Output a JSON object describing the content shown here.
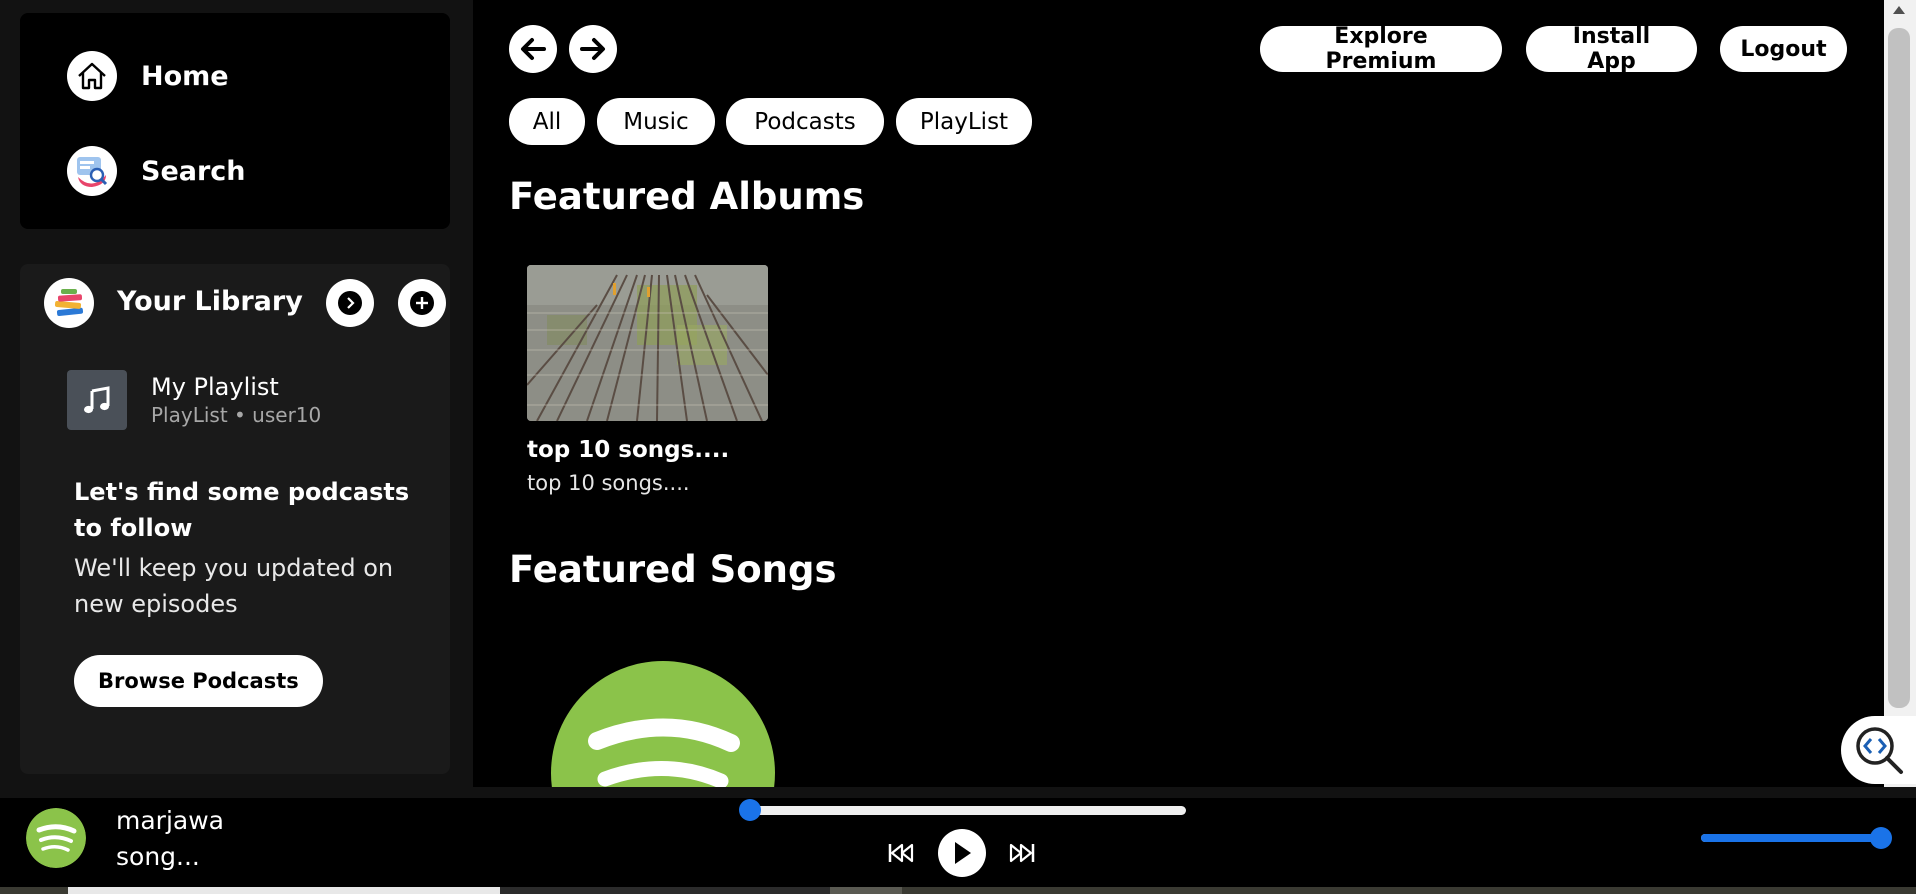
{
  "sidebar": {
    "nav": [
      {
        "label": "Home",
        "icon": "home-icon"
      },
      {
        "label": "Search",
        "icon": "search-icon"
      }
    ],
    "library": {
      "title": "Your Library",
      "expand_icon": "chevron-right-icon",
      "add_icon": "plus-icon",
      "playlist": {
        "title": "My Playlist",
        "subtitle": "PlayList • user10",
        "icon": "music-note-icon"
      },
      "podcast_card": {
        "title": "Let's find some podcasts to follow",
        "text": "We'll keep you updated on new episodes",
        "button": "Browse Podcasts"
      }
    }
  },
  "header": {
    "back_icon": "arrow-left-icon",
    "forward_icon": "arrow-right-icon",
    "buttons": {
      "premium": "Explore Premium",
      "install": "Install App",
      "logout": "Logout"
    }
  },
  "filters": [
    "All",
    "Music",
    "Podcasts",
    "PlayList"
  ],
  "main": {
    "featured_albums_title": "Featured Albums",
    "albums": [
      {
        "title": "top 10 songs....",
        "subtitle": "top 10 songs....",
        "image": "railway-tracks-photo"
      }
    ],
    "featured_songs_title": "Featured Songs",
    "songs": [
      {
        "image": "spotify-logo"
      }
    ]
  },
  "player": {
    "now_playing": {
      "title": "marjawa",
      "subtitle": "song...",
      "image": "spotify-logo"
    },
    "progress": 0.0,
    "volume": 1.0,
    "controls": {
      "prev": "skip-back-icon",
      "play": "play-icon",
      "next": "skip-forward-icon"
    }
  },
  "colors": {
    "accent": "#1a73e8",
    "background": "#000000",
    "panel": "#1a1a1a",
    "spotify_green": "#8bc34a"
  }
}
